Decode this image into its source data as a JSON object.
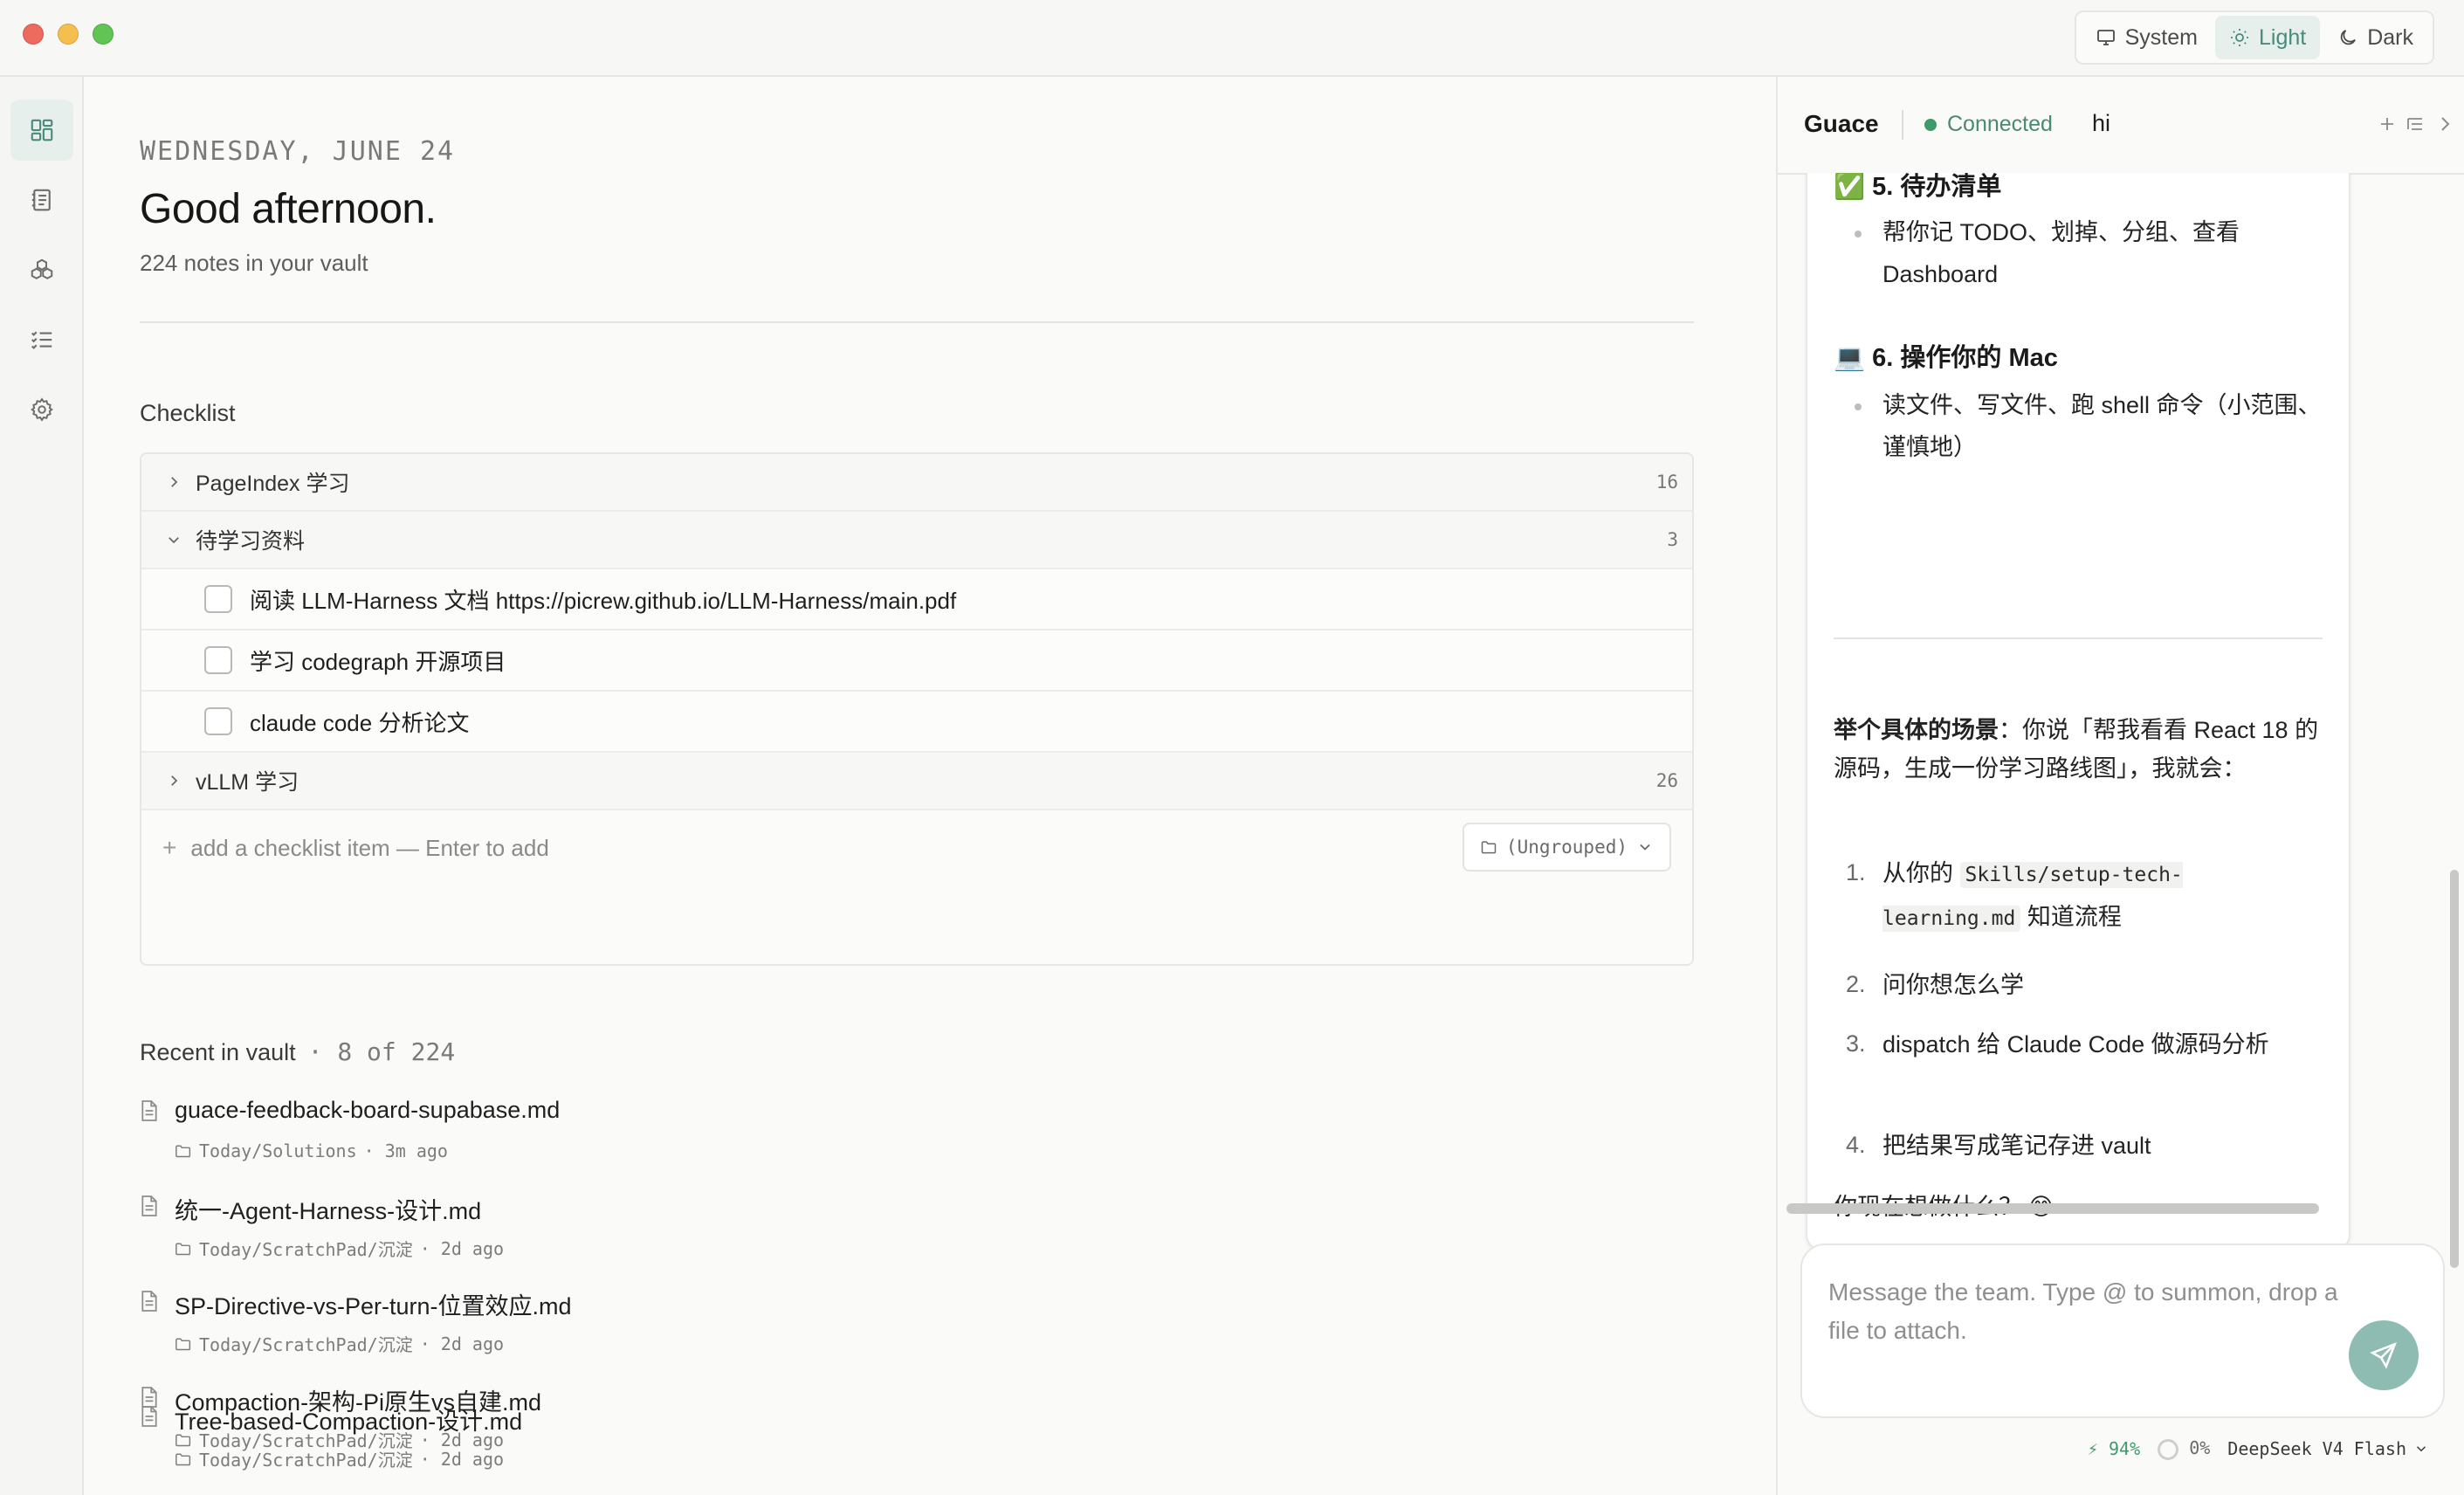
{
  "theme": {
    "options": [
      {
        "label": "System",
        "icon": "monitor-icon"
      },
      {
        "label": "Light",
        "icon": "sun-icon"
      },
      {
        "label": "Dark",
        "icon": "moon-icon"
      }
    ],
    "selected": "Light"
  },
  "rail": {
    "items": [
      "dashboard-icon",
      "notebook-icon",
      "cubes-icon",
      "checklist-icon",
      "gear-icon"
    ],
    "active": "dashboard-icon"
  },
  "main": {
    "date": "WEDNESDAY, JUNE 24",
    "greeting": "Good afternoon.",
    "note_count": "224 notes in your vault",
    "checklist": {
      "title": "Checklist",
      "groups": [
        {
          "label": "PageIndex 学习",
          "count": "16",
          "expanded": false
        },
        {
          "label": "待学习资料",
          "count": "3",
          "expanded": true,
          "items": [
            "阅读 LLM-Harness 文档 https://picrew.github.io/LLM-Harness/main.pdf",
            "学习 codegraph 开源项目",
            "claude code 分析论文"
          ]
        },
        {
          "label": "vLLM 学习",
          "count": "26",
          "expanded": false
        }
      ],
      "add_placeholder": "add a checklist item — Enter to add",
      "group_select": "(Ungrouped)"
    },
    "recent": {
      "title": "Recent in vault",
      "count": "· 8 of 224",
      "items": [
        {
          "name": "guace-feedback-board-supabase.md",
          "path": "Today/Solutions",
          "time": "· 3m ago"
        },
        {
          "name": "统一-Agent-Harness-设计.md",
          "path": "Today/ScratchPad/沉淀",
          "time": "· 2d ago"
        },
        {
          "name": "SP-Directive-vs-Per-turn-位置效应.md",
          "path": "Today/ScratchPad/沉淀",
          "time": "· 2d ago"
        },
        {
          "name": "Compaction-架构-Pi原生vs自建.md",
          "path": "Today/ScratchPad/沉淀",
          "time": "· 2d ago"
        },
        {
          "name": "Tree-based-Compaction-设计.md",
          "path": "Today/ScratchPad/沉淀",
          "time": "· 2d ago"
        }
      ]
    }
  },
  "chat": {
    "title": "Guace",
    "status": "Connected",
    "session": "hi",
    "colors": {
      "accent": "#4a8a7c",
      "connected": "#3f9a6a",
      "send": "#8fbcb2"
    },
    "message": {
      "h5": "✅ 5. 待办清单",
      "b5": "帮你记 TODO、划掉、分组、查看 Dashboard",
      "h6": "💻 6. 操作你的 Mac",
      "b6": "读文件、写文件、跑 shell 命令（小范围、谨慎地）",
      "scenario_bold": "举个具体的场景",
      "scenario_text": "：你说「帮我看看 React 18 的源码，生成一份学习路线图」，我就会：",
      "steps": [
        {
          "n": "1.",
          "pre": "从你的 ",
          "code": "Skills/setup-tech-learning.md",
          "post": " 知道流程"
        },
        {
          "n": "2.",
          "text": "问你想怎么学"
        },
        {
          "n": "3.",
          "text": "dispatch 给 Claude Code 做源码分析"
        },
        {
          "n": "4.",
          "text": "把结果写成笔记存进 vault"
        }
      ],
      "closing": "你现在想做什么？ 😊"
    },
    "composer_placeholder": "Message the team. Type @ to summon, drop a file to attach.",
    "footer": {
      "battery": "⚡ 94%",
      "context": "0%",
      "model": "DeepSeek V4 Flash"
    }
  }
}
